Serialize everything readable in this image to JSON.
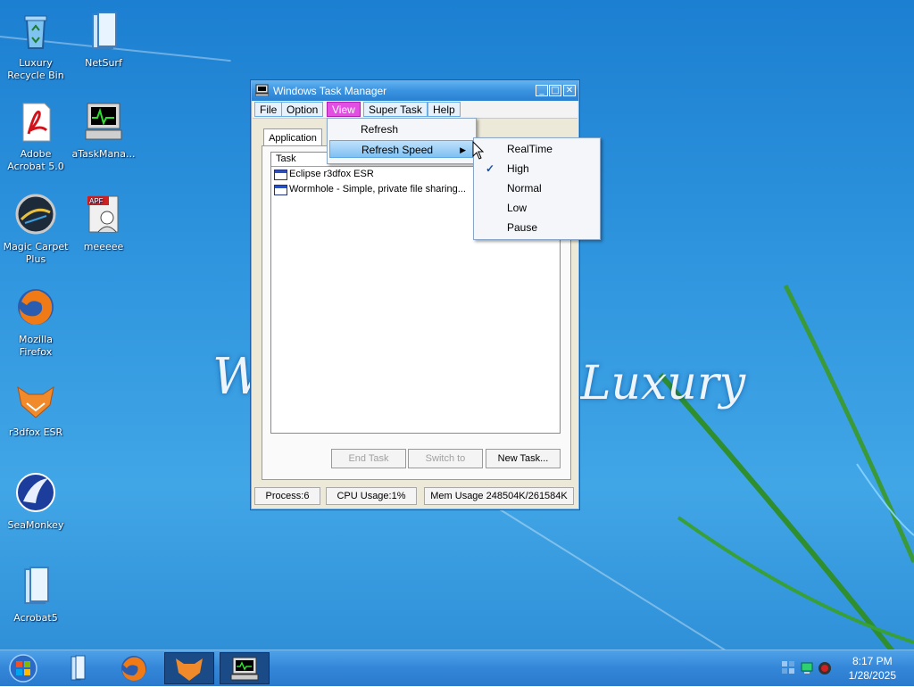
{
  "desktop": {
    "icons": [
      {
        "label_1": "Luxury",
        "label_2": "Recycle Bin",
        "icon": "recycle-bin-icon"
      },
      {
        "label_1": "NetSurf",
        "label_2": "",
        "icon": "folder-icon"
      },
      {
        "label_1": "Adobe",
        "label_2": "Acrobat 5.0",
        "icon": "acrobat-icon"
      },
      {
        "label_1": "aTaskMana...",
        "label_2": "",
        "icon": "task-manager-icon"
      },
      {
        "label_1": "Magic Carpet",
        "label_2": "Plus",
        "icon": "magic-carpet-icon"
      },
      {
        "label_1": "meeeee",
        "label_2": "",
        "icon": "apf-file-icon"
      },
      {
        "label_1": "Mozilla",
        "label_2": "Firefox",
        "icon": "firefox-icon"
      },
      {
        "label_1": "r3dfox ESR",
        "label_2": "",
        "icon": "r3dfox-icon"
      },
      {
        "label_1": "SeaMonkey",
        "label_2": "",
        "icon": "seamonkey-icon"
      },
      {
        "label_1": "Acrobat5",
        "label_2": "",
        "icon": "folder-icon"
      }
    ],
    "wallpaper_text_left": "W",
    "wallpaper_text_right": "Luxury"
  },
  "window": {
    "title": "Windows Task Manager",
    "menu": [
      "File",
      "Option",
      "View",
      "Super Task",
      "Help"
    ],
    "active_menu": "View",
    "tab": "Application",
    "list_header": "Task",
    "tasks": [
      "Eclipse r3dfox ESR",
      "Wormhole - Simple, private file sharing..."
    ],
    "buttons": {
      "end_task": "End Task",
      "switch_to": "Switch to",
      "new_task": "New Task..."
    },
    "status": {
      "process": "Process:6",
      "cpu": "CPU Usage:1%",
      "mem": "Mem Usage 248504K/261584K"
    }
  },
  "view_menu": {
    "items": [
      "Refresh",
      "Refresh Speed"
    ]
  },
  "speed_menu": {
    "items": [
      "RealTime",
      "High",
      "Normal",
      "Low",
      "Pause"
    ],
    "checked": "High",
    "check_mark": "✓"
  },
  "taskbar": {
    "time": "8:17 PM",
    "date": "1/28/2025"
  },
  "colors": {
    "menu_active": "#e34fe3",
    "titlebar": "#3a93e0",
    "desktop": "#2f95de"
  }
}
